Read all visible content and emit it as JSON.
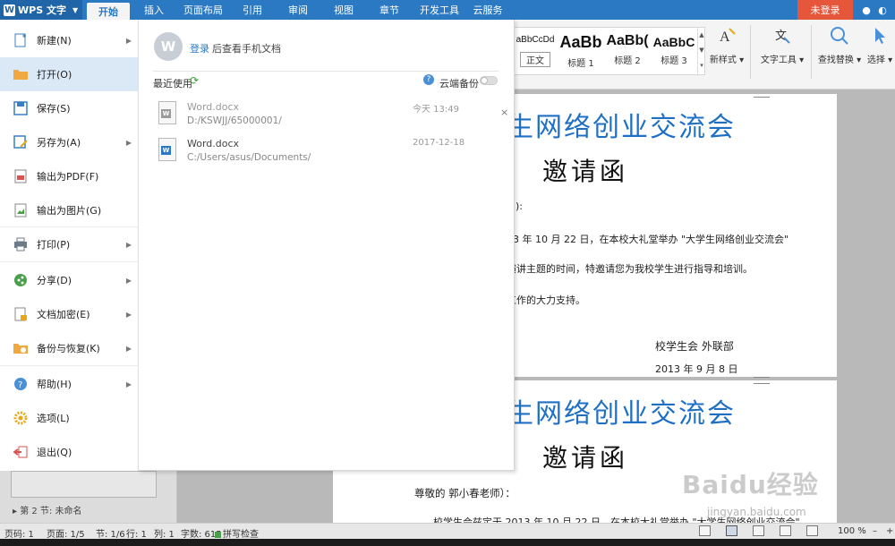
{
  "app": {
    "name": "WPS 文字",
    "logo_letter": "W"
  },
  "tabs": [
    "开始",
    "插入",
    "页面布局",
    "引用",
    "审阅",
    "视图",
    "章节",
    "开发工具",
    "云服务"
  ],
  "login_button": "未登录",
  "ribbon": {
    "styles": [
      {
        "sample": "aBbCcDd",
        "name": "正文"
      },
      {
        "sample": "AaBb",
        "name": "标题 1"
      },
      {
        "sample": "AaBb(",
        "name": "标题 2"
      },
      {
        "sample": "AaBbC",
        "name": "标题 3"
      }
    ],
    "new_style": "新样式",
    "text_tools": "文字工具",
    "find_replace": "查找替换",
    "select": "选择"
  },
  "file_menu": {
    "items": [
      {
        "label": "新建(N)",
        "has_submenu": true
      },
      {
        "label": "打开(O)",
        "has_submenu": false,
        "selected": true
      },
      {
        "label": "保存(S)",
        "has_submenu": false
      },
      {
        "label": "另存为(A)",
        "has_submenu": true
      },
      {
        "label": "输出为PDF(F)",
        "has_submenu": false
      },
      {
        "label": "输出为图片(G)",
        "has_submenu": false
      },
      {
        "label": "打印(P)",
        "has_submenu": true
      },
      {
        "label": "分享(D)",
        "has_submenu": true
      },
      {
        "label": "文档加密(E)",
        "has_submenu": true
      },
      {
        "label": "备份与恢复(K)",
        "has_submenu": true
      },
      {
        "label": "帮助(H)",
        "has_submenu": true
      },
      {
        "label": "选项(L)",
        "has_submenu": false
      },
      {
        "label": "退出(Q)",
        "has_submenu": false
      }
    ],
    "login_link": "登录",
    "login_text": "后查看手机文档",
    "recent_label": "最近使用",
    "cloud_backup_label": "云端备份",
    "cloud_backup_on": false,
    "recent_files": [
      {
        "name": "Word.docx",
        "path": "D:/KSWJJ/65000001/",
        "time": "今天 13:49",
        "greyed": true
      },
      {
        "name": "Word.docx",
        "path": "C:/Users/asus/Documents/",
        "time": "2017-12-18",
        "greyed": false
      }
    ]
  },
  "document": {
    "page1": {
      "title": "生网络创业交流会",
      "subtitle": "邀请函",
      "line1": "):",
      "line2": "3 年 10 月 22 日，在本校大礼堂举办 \"大学生网络创业交流会\"",
      "line3": "演讲主题的时间，特邀请您为我校学生进行指导和培训。",
      "line4": "工作的大力支持。",
      "sign": "校学生会 外联部",
      "date": "2013 年 9 月 8 日"
    },
    "page2": {
      "title": "生网络创业交流会",
      "subtitle": "邀请函",
      "greeting": "尊敬的    郭小春老师）：",
      "line1": "校学生会兹定于 2013 年 10 月 22 日，在本校大礼堂举办 \"大学生网络创业交流会\""
    }
  },
  "nav_pane": {
    "section": "第 2 节: 未命名"
  },
  "status": {
    "page_code": "页码: 1",
    "page": "页面: 1/5",
    "section": "节: 1/6",
    "row": "行: 1",
    "col": "列: 1",
    "word_count": "字数: 615",
    "spell_check": "拼写检查",
    "zoom": "100 %"
  },
  "watermark": {
    "text": "Baidu经验",
    "sub": "jingyan.baidu.com"
  }
}
